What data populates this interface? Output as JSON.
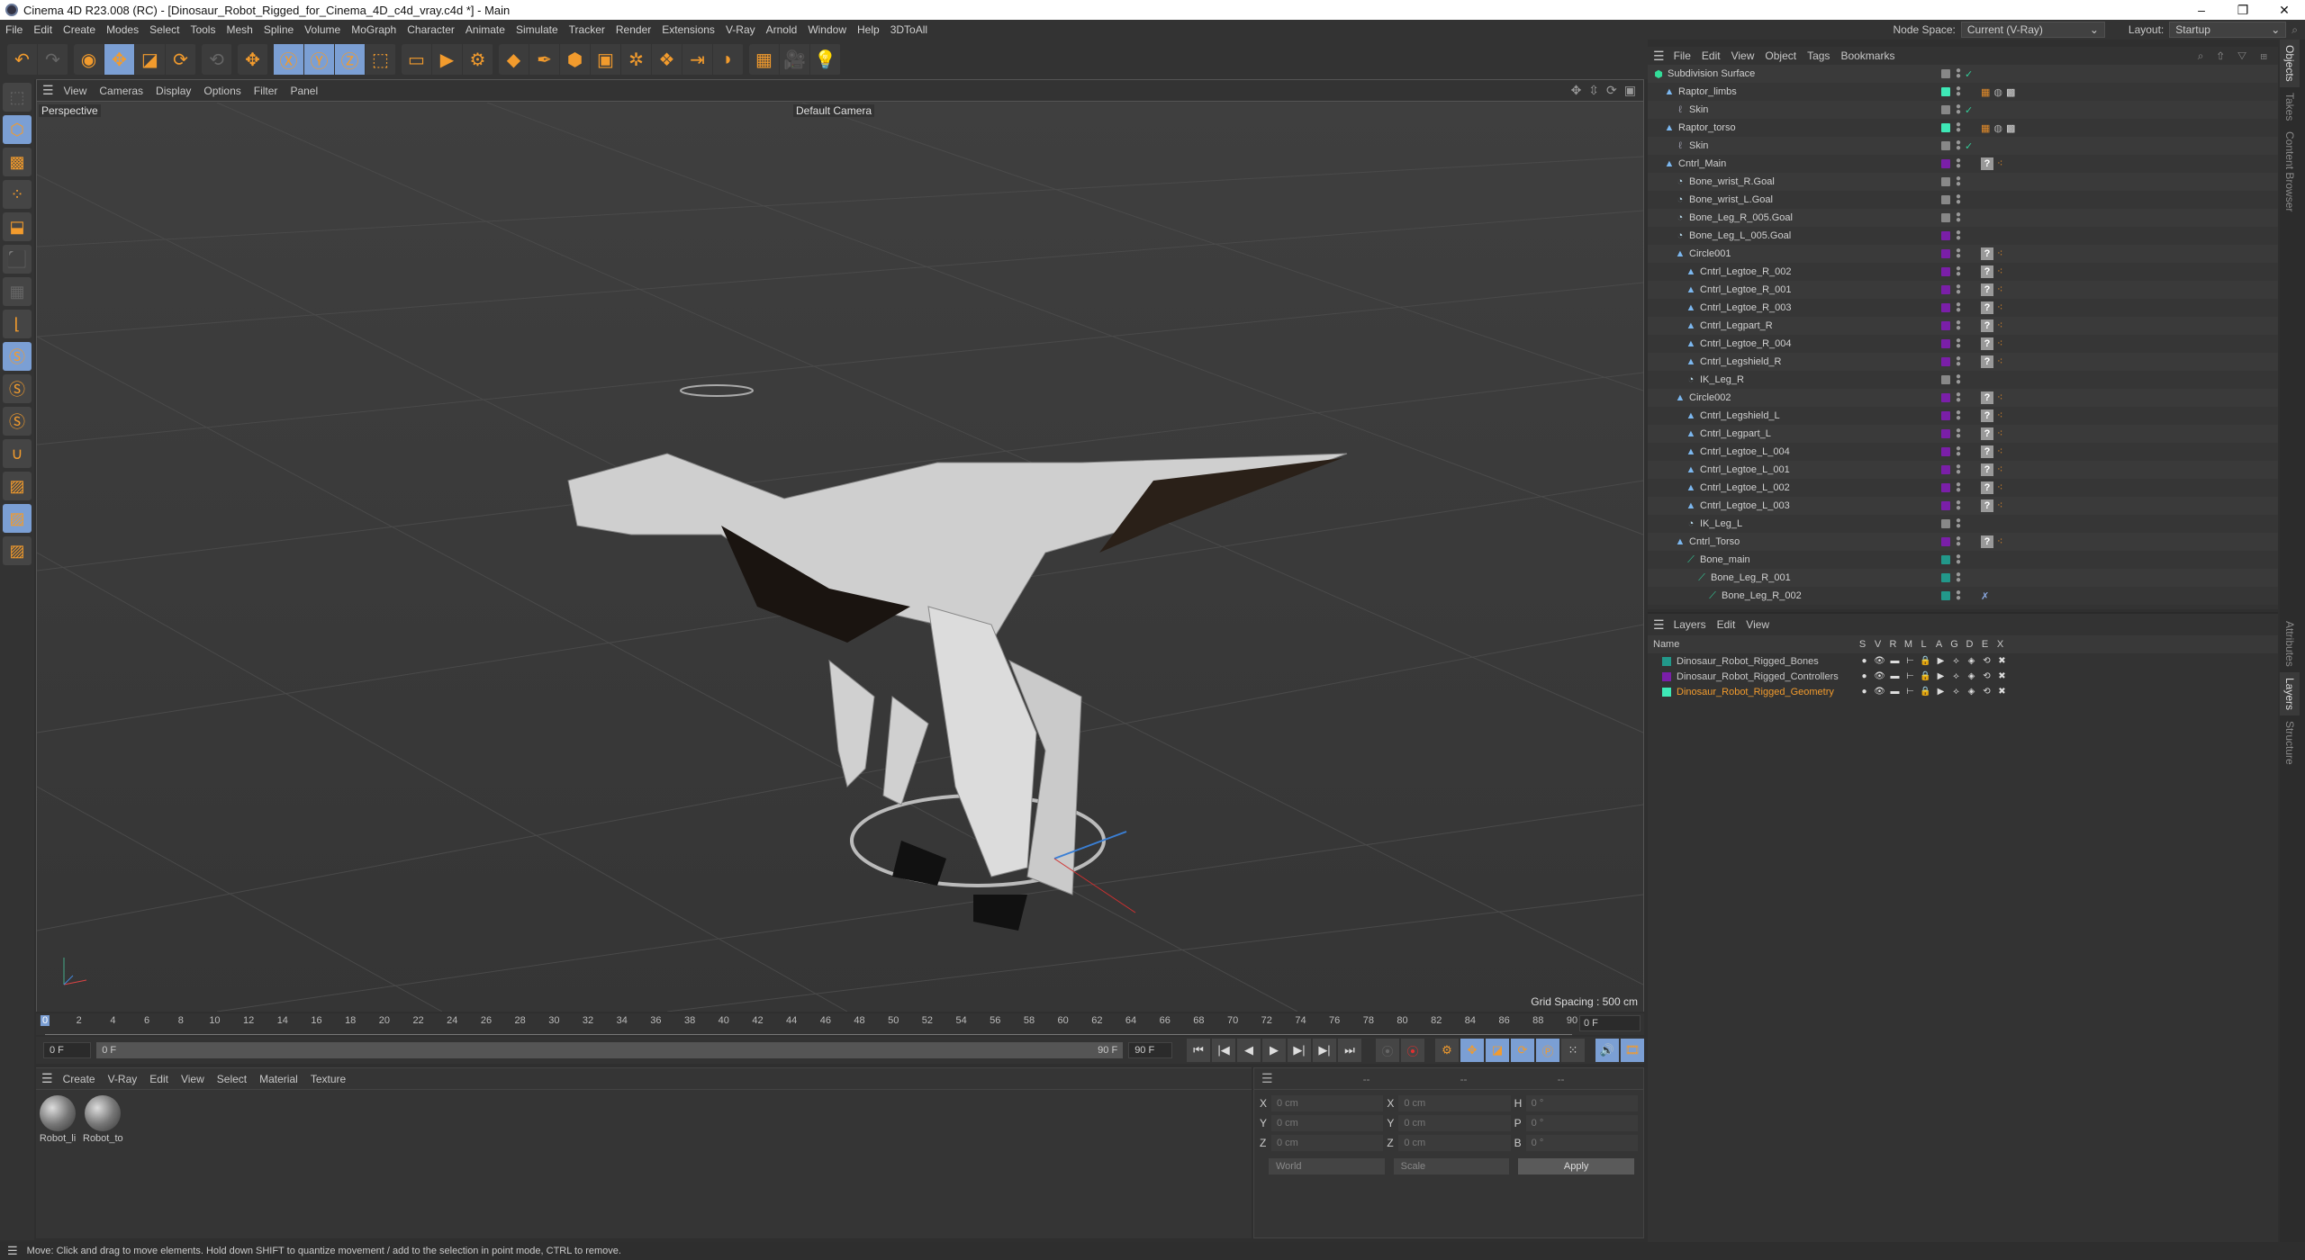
{
  "window": {
    "title": "Cinema 4D R23.008 (RC) - [Dinosaur_Robot_Rigged_for_Cinema_4D_c4d_vray.c4d *] - Main",
    "controls": [
      "–",
      "❐",
      "✕"
    ]
  },
  "menubar": {
    "items": [
      "File",
      "Edit",
      "Create",
      "Modes",
      "Select",
      "Tools",
      "Mesh",
      "Spline",
      "Volume",
      "MoGraph",
      "Character",
      "Animate",
      "Simulate",
      "Tracker",
      "Render",
      "Extensions",
      "V-Ray",
      "Arnold",
      "Window",
      "Help",
      "3DToAll"
    ],
    "node_space_label": "Node Space:",
    "node_space_value": "Current (V-Ray)",
    "layout_label": "Layout:",
    "layout_value": "Startup"
  },
  "toolbar": {
    "groups": [
      [
        {
          "icon": "undo-icon",
          "glyph": "↶",
          "state": "normal"
        },
        {
          "icon": "redo-icon",
          "glyph": "↷",
          "state": "dim"
        }
      ],
      [
        {
          "icon": "select-icon",
          "glyph": "◉",
          "state": "normal"
        },
        {
          "icon": "move-icon",
          "glyph": "✥",
          "state": "on"
        },
        {
          "icon": "scale-icon",
          "glyph": "◪",
          "state": "normal"
        },
        {
          "icon": "rotate-icon",
          "glyph": "⟳",
          "state": "normal"
        }
      ],
      [
        {
          "icon": "psr-icon",
          "glyph": "⟲",
          "state": "dim"
        }
      ],
      [
        {
          "icon": "transform-icon",
          "glyph": "✥",
          "state": "normal"
        }
      ],
      [
        {
          "icon": "x-axis-icon",
          "glyph": "Ⓧ",
          "state": "on"
        },
        {
          "icon": "y-axis-icon",
          "glyph": "Ⓨ",
          "state": "on"
        },
        {
          "icon": "z-axis-icon",
          "glyph": "Ⓩ",
          "state": "on"
        },
        {
          "icon": "coordinate-system-icon",
          "glyph": "⬚",
          "state": "normal"
        }
      ],
      [
        {
          "icon": "render-view-icon",
          "glyph": "▭",
          "state": "normal"
        },
        {
          "icon": "render-picture-viewer-icon",
          "glyph": "▶",
          "state": "normal"
        },
        {
          "icon": "render-settings-icon",
          "glyph": "⚙",
          "state": "normal"
        }
      ],
      [
        {
          "icon": "cube-icon",
          "glyph": "◆",
          "state": "normal"
        },
        {
          "icon": "pen-icon",
          "glyph": "✒",
          "state": "normal"
        },
        {
          "icon": "subdivision-icon",
          "glyph": "⬢",
          "state": "normal"
        },
        {
          "icon": "extrude-icon",
          "glyph": "▣",
          "state": "normal"
        },
        {
          "icon": "mograph-icon",
          "glyph": "✲",
          "state": "normal"
        },
        {
          "icon": "cloner-icon",
          "glyph": "❖",
          "state": "normal"
        },
        {
          "icon": "deformer-icon",
          "glyph": "⇥",
          "state": "normal"
        },
        {
          "icon": "field-icon",
          "glyph": "◗",
          "state": "normal"
        }
      ],
      [
        {
          "icon": "floor-icon",
          "glyph": "▦",
          "state": "normal"
        },
        {
          "icon": "camera-icon",
          "glyph": "🎥",
          "state": "normal"
        },
        {
          "icon": "light-icon",
          "glyph": "💡",
          "state": "normal"
        }
      ]
    ]
  },
  "leftbar": {
    "items": [
      {
        "icon": "make-editable-icon",
        "glyph": "⬚",
        "state": "dim"
      },
      {
        "icon": "model-mode-icon",
        "glyph": "⬡",
        "state": "on"
      },
      {
        "icon": "texture-mode-icon",
        "glyph": "▩",
        "state": "normal"
      },
      {
        "icon": "points-mode-icon",
        "glyph": "⁘",
        "state": "normal"
      },
      {
        "icon": "edges-mode-icon",
        "glyph": "⬓",
        "state": "normal"
      },
      {
        "icon": "polygons-mode-icon",
        "glyph": "⬛",
        "state": "normal"
      },
      {
        "icon": "uv-mode-icon",
        "glyph": "▦",
        "state": "dim"
      },
      {
        "icon": "axis-icon",
        "glyph": "⌊",
        "state": "normal"
      },
      {
        "icon": "snap-icon",
        "glyph": "Ⓢ",
        "state": "on"
      },
      {
        "icon": "snap-settings-icon",
        "glyph": "Ⓢ",
        "state": "normal"
      },
      {
        "icon": "snap-workplane-icon",
        "glyph": "Ⓢ",
        "state": "normal"
      },
      {
        "icon": "magnet-icon",
        "glyph": "∪",
        "state": "normal"
      },
      {
        "icon": "workplane-icon",
        "glyph": "▨",
        "state": "normal"
      },
      {
        "icon": "locked-workplane-icon",
        "glyph": "▨",
        "state": "on"
      },
      {
        "icon": "workplane-rotate-icon",
        "glyph": "▨",
        "state": "normal"
      }
    ]
  },
  "viewport": {
    "menu": [
      "View",
      "Cameras",
      "Display",
      "Options",
      "Filter",
      "Panel"
    ],
    "view_name": "Perspective",
    "camera_name": "Default Camera",
    "grid_spacing": "Grid Spacing : 500 cm",
    "nav_icons": [
      "✥",
      "⇳",
      "⟳",
      "▣"
    ]
  },
  "timeline": {
    "ticks": [
      0,
      2,
      4,
      6,
      8,
      10,
      12,
      14,
      16,
      18,
      20,
      22,
      24,
      26,
      28,
      30,
      32,
      34,
      36,
      38,
      40,
      42,
      44,
      46,
      48,
      50,
      52,
      54,
      56,
      58,
      60,
      62,
      64,
      66,
      68,
      70,
      72,
      74,
      76,
      78,
      80,
      82,
      84,
      86,
      88,
      90
    ],
    "current_frame": "0 F",
    "range_max": 90
  },
  "playback": {
    "start_field": "0 F",
    "slider_start": "0 F",
    "slider_end": "90 F",
    "end_field": "90 F",
    "buttons": [
      {
        "icon": "go-to-start-icon",
        "glyph": "⏮"
      },
      {
        "icon": "previous-key-icon",
        "glyph": "|◀"
      },
      {
        "icon": "previous-frame-icon",
        "glyph": "◀"
      },
      {
        "icon": "play-icon",
        "glyph": "▶"
      },
      {
        "icon": "next-frame-icon",
        "glyph": "▶|"
      },
      {
        "icon": "next-key-icon",
        "glyph": "▶|"
      },
      {
        "icon": "go-to-end-icon",
        "glyph": "⏭"
      }
    ],
    "record_buttons": [
      {
        "icon": "record-active-objects-icon",
        "glyph": "⦿",
        "state": "dim"
      },
      {
        "icon": "autokeying-icon",
        "glyph": "⦿",
        "state": "red"
      }
    ],
    "key_buttons": [
      {
        "icon": "keyframe-selection-icon",
        "glyph": "⚙",
        "state": "or"
      },
      {
        "icon": "position-key-icon",
        "glyph": "✥",
        "state": "on"
      },
      {
        "icon": "scale-key-icon",
        "glyph": "◪",
        "state": "on"
      },
      {
        "icon": "rotation-key-icon",
        "glyph": "⟳",
        "state": "on"
      },
      {
        "icon": "parameter-key-icon",
        "glyph": "Ⓟ",
        "state": "on"
      },
      {
        "icon": "point-level-key-icon",
        "glyph": "⁙",
        "state": "normal"
      }
    ],
    "extra_buttons": [
      {
        "icon": "sound-icon",
        "glyph": "🔊",
        "state": "on"
      },
      {
        "icon": "film-icon",
        "glyph": "🎞",
        "state": "on"
      }
    ]
  },
  "material_manager": {
    "menu": [
      "Create",
      "V-Ray",
      "Edit",
      "View",
      "Select",
      "Material",
      "Texture"
    ],
    "materials": [
      {
        "name": "Robot_li"
      },
      {
        "name": "Robot_to"
      }
    ]
  },
  "coordinates": {
    "headers": [
      "--",
      "--",
      "--"
    ],
    "rows": [
      [
        {
          "axis": "X",
          "value": "0 cm"
        },
        {
          "axis": "X",
          "value": "0 cm"
        },
        {
          "axis": "H",
          "value": "0 °"
        }
      ],
      [
        {
          "axis": "Y",
          "value": "0 cm"
        },
        {
          "axis": "Y",
          "value": "0 cm"
        },
        {
          "axis": "P",
          "value": "0 °"
        }
      ],
      [
        {
          "axis": "Z",
          "value": "0 cm"
        },
        {
          "axis": "Z",
          "value": "0 cm"
        },
        {
          "axis": "B",
          "value": "0 °"
        }
      ]
    ],
    "mode_select": "World",
    "type_select": "Scale",
    "apply_label": "Apply"
  },
  "object_manager": {
    "menu": [
      "File",
      "Edit",
      "View",
      "Object",
      "Tags",
      "Bookmarks"
    ],
    "header_icons": "⌕ ⇧ ▽ ⊞",
    "objects": [
      {
        "name": "Subdivision Surface",
        "depth": 0,
        "type": "subd",
        "color": "#888888",
        "check": true,
        "tags": []
      },
      {
        "name": "Raptor_limbs",
        "depth": 1,
        "type": "null",
        "color": "#3ee8b6",
        "check": false,
        "tags": [
          "material"
        ]
      },
      {
        "name": "Skin",
        "depth": 2,
        "type": "skin",
        "color": "#888888",
        "check": true,
        "tags": []
      },
      {
        "name": "Raptor_torso",
        "depth": 1,
        "type": "null",
        "color": "#3ee8b6",
        "check": false,
        "tags": [
          "material"
        ]
      },
      {
        "name": "Skin",
        "depth": 2,
        "type": "skin",
        "color": "#888888",
        "check": true,
        "tags": []
      },
      {
        "name": "Cntrl_Main",
        "depth": 1,
        "type": "null",
        "color": "#7a1fa8",
        "check": false,
        "tags": [
          "unknown"
        ]
      },
      {
        "name": "Bone_wrist_R.Goal",
        "depth": 2,
        "type": "goal",
        "color": "#888888",
        "check": false,
        "tags": []
      },
      {
        "name": "Bone_wrist_L.Goal",
        "depth": 2,
        "type": "goal",
        "color": "#888888",
        "check": false,
        "tags": []
      },
      {
        "name": "Bone_Leg_R_005.Goal",
        "depth": 2,
        "type": "goal",
        "color": "#888888",
        "check": false,
        "tags": []
      },
      {
        "name": "Bone_Leg_L_005.Goal",
        "depth": 2,
        "type": "goal",
        "color": "#7a1fa8",
        "check": false,
        "tags": []
      },
      {
        "name": "Circle001",
        "depth": 2,
        "type": "null",
        "color": "#7a1fa8",
        "check": false,
        "tags": [
          "unknown"
        ]
      },
      {
        "name": "Cntrl_Legtoe_R_002",
        "depth": 3,
        "type": "null",
        "color": "#7a1fa8",
        "check": false,
        "tags": [
          "unknown"
        ]
      },
      {
        "name": "Cntrl_Legtoe_R_001",
        "depth": 3,
        "type": "null",
        "color": "#7a1fa8",
        "check": false,
        "tags": [
          "unknown"
        ]
      },
      {
        "name": "Cntrl_Legtoe_R_003",
        "depth": 3,
        "type": "null",
        "color": "#7a1fa8",
        "check": false,
        "tags": [
          "unknown"
        ]
      },
      {
        "name": "Cntrl_Legpart_R",
        "depth": 3,
        "type": "null",
        "color": "#7a1fa8",
        "check": false,
        "tags": [
          "unknown"
        ]
      },
      {
        "name": "Cntrl_Legtoe_R_004",
        "depth": 3,
        "type": "null",
        "color": "#7a1fa8",
        "check": false,
        "tags": [
          "unknown"
        ]
      },
      {
        "name": "Cntrl_Legshield_R",
        "depth": 3,
        "type": "null",
        "color": "#7a1fa8",
        "check": false,
        "tags": [
          "unknown"
        ]
      },
      {
        "name": "IK_Leg_R",
        "depth": 3,
        "type": "goal",
        "color": "#888888",
        "check": false,
        "tags": []
      },
      {
        "name": "Circle002",
        "depth": 2,
        "type": "null",
        "color": "#7a1fa8",
        "check": false,
        "tags": [
          "unknown"
        ]
      },
      {
        "name": "Cntrl_Legshield_L",
        "depth": 3,
        "type": "null",
        "color": "#7a1fa8",
        "check": false,
        "tags": [
          "unknown"
        ]
      },
      {
        "name": "Cntrl_Legpart_L",
        "depth": 3,
        "type": "null",
        "color": "#7a1fa8",
        "check": false,
        "tags": [
          "unknown"
        ]
      },
      {
        "name": "Cntrl_Legtoe_L_004",
        "depth": 3,
        "type": "null",
        "color": "#7a1fa8",
        "check": false,
        "tags": [
          "unknown"
        ]
      },
      {
        "name": "Cntrl_Legtoe_L_001",
        "depth": 3,
        "type": "null",
        "color": "#7a1fa8",
        "check": false,
        "tags": [
          "unknown"
        ]
      },
      {
        "name": "Cntrl_Legtoe_L_002",
        "depth": 3,
        "type": "null",
        "color": "#7a1fa8",
        "check": false,
        "tags": [
          "unknown"
        ]
      },
      {
        "name": "Cntrl_Legtoe_L_003",
        "depth": 3,
        "type": "null",
        "color": "#7a1fa8",
        "check": false,
        "tags": [
          "unknown"
        ]
      },
      {
        "name": "IK_Leg_L",
        "depth": 3,
        "type": "goal",
        "color": "#888888",
        "check": false,
        "tags": []
      },
      {
        "name": "Cntrl_Torso",
        "depth": 2,
        "type": "null",
        "color": "#7a1fa8",
        "check": false,
        "tags": [
          "unknown"
        ]
      },
      {
        "name": "Bone_main",
        "depth": 3,
        "type": "bone",
        "color": "#22988a",
        "check": false,
        "tags": []
      },
      {
        "name": "Bone_Leg_R_001",
        "depth": 4,
        "type": "bone",
        "color": "#22988a",
        "check": false,
        "tags": []
      },
      {
        "name": "Bone_Leg_R_002",
        "depth": 5,
        "type": "bone",
        "color": "#22988a",
        "check": false,
        "tags": [
          "ik"
        ]
      }
    ]
  },
  "layer_manager": {
    "menu": [
      "Layers",
      "Edit",
      "View"
    ],
    "name_header": "Name",
    "columns": [
      "S",
      "V",
      "R",
      "M",
      "L",
      "A",
      "G",
      "D",
      "E",
      "X"
    ],
    "layers": [
      {
        "name": "Dinosaur_Robot_Rigged_Bones",
        "color": "#22988a",
        "selected": false
      },
      {
        "name": "Dinosaur_Robot_Rigged_Controllers",
        "color": "#7a1fa8",
        "selected": false
      },
      {
        "name": "Dinosaur_Robot_Rigged_Geometry",
        "color": "#3ee8b6",
        "selected": true
      }
    ],
    "row_icons": [
      "●",
      "👁",
      "▬",
      "⊢",
      "🔒",
      "▶",
      "⟡",
      "◈",
      "⟲",
      "✖"
    ]
  },
  "side_tabs": {
    "top": [
      {
        "label": "Objects",
        "active": true
      },
      {
        "label": "Takes",
        "active": false
      },
      {
        "label": "Content Browser",
        "active": false
      }
    ],
    "bottom": [
      {
        "label": "Attributes",
        "active": false
      },
      {
        "label": "Layers",
        "active": true
      },
      {
        "label": "Structure",
        "active": false
      }
    ]
  },
  "statusbar": {
    "text": "Move: Click and drag to move elements. Hold down SHIFT to quantize movement / add to the selection in point mode, CTRL to remove."
  },
  "colors": {
    "accent_blue": "#7b9fd4",
    "accent_orange": "#f29b2d",
    "selected_layer_text": "#f29b2d"
  }
}
